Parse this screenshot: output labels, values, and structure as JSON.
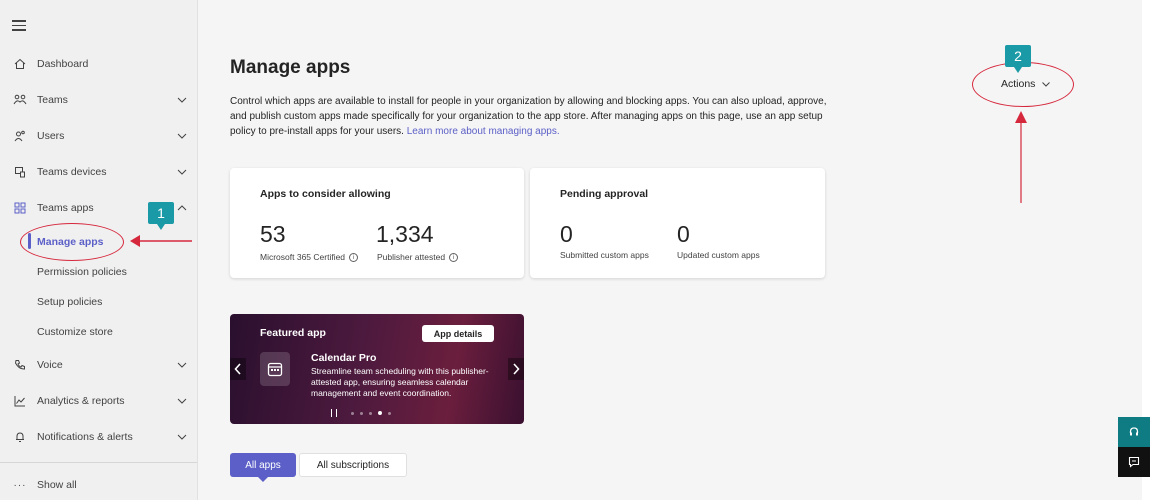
{
  "sidebar": {
    "items": [
      {
        "label": "Dashboard",
        "icon": "home-icon"
      },
      {
        "label": "Teams",
        "icon": "teams-icon"
      },
      {
        "label": "Users",
        "icon": "users-icon"
      },
      {
        "label": "Teams devices",
        "icon": "devices-icon"
      },
      {
        "label": "Teams apps",
        "icon": "apps-icon"
      },
      {
        "label": "Voice",
        "icon": "phone-icon"
      },
      {
        "label": "Analytics & reports",
        "icon": "chart-icon"
      },
      {
        "label": "Notifications & alerts",
        "icon": "bell-icon"
      }
    ],
    "sub_items": [
      "Manage apps",
      "Permission policies",
      "Setup policies",
      "Customize store"
    ],
    "show_all": "Show all"
  },
  "page": {
    "title": "Manage apps",
    "description": "Control which apps are available to install for people in your organization by allowing and blocking apps. You can also upload, approve, and publish custom apps made specifically for your organization to the app store. After managing apps on this page, use an app setup policy to pre-install apps for your users.",
    "learn_more": "Learn more about managing apps.",
    "actions_label": "Actions"
  },
  "cards": {
    "consider": {
      "title": "Apps to consider allowing",
      "certified_count": "53",
      "certified_label": "Microsoft 365 Certified",
      "attested_count": "1,334",
      "attested_label": "Publisher attested"
    },
    "pending": {
      "title": "Pending approval",
      "submitted_count": "0",
      "submitted_label": "Submitted custom apps",
      "updated_count": "0",
      "updated_label": "Updated custom apps"
    }
  },
  "featured": {
    "heading": "Featured app",
    "details_button": "App details",
    "app_name": "Calendar Pro",
    "app_desc": "Streamline team scheduling with this publisher-attested app, ensuring seamless calendar management and event coordination.",
    "dots_total": 5,
    "dot_active": 4
  },
  "tabs": [
    "All apps",
    "All subscriptions"
  ],
  "annotations": {
    "badge1": "1",
    "badge2": "2",
    "accent_color": "#d6283d"
  },
  "colors": {
    "brand": "#5b5fc7",
    "teal": "#1a9aa6"
  }
}
